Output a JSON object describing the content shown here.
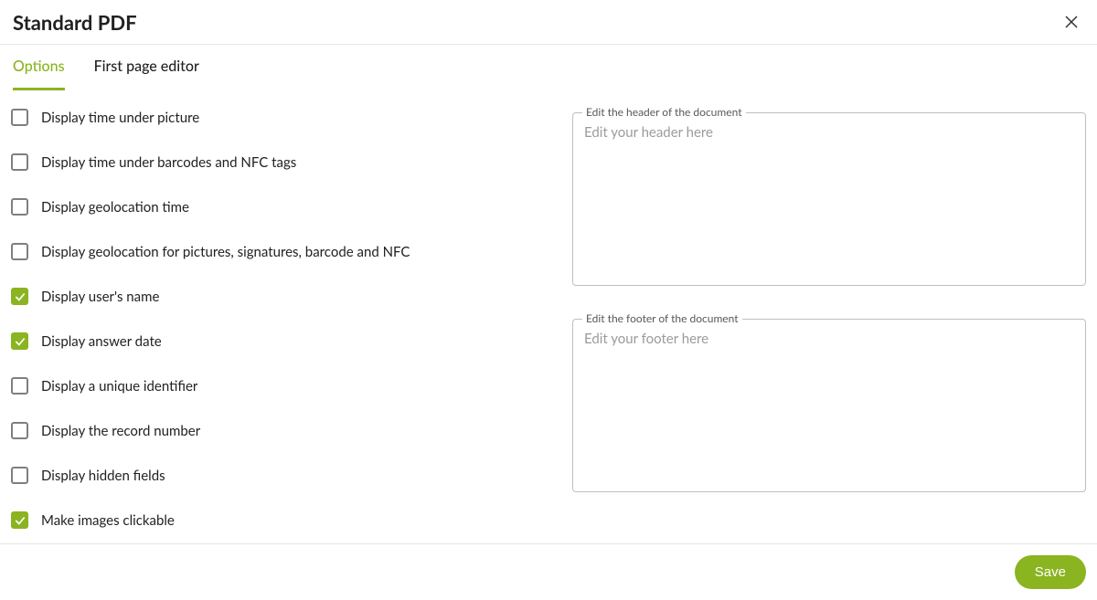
{
  "header": {
    "title": "Standard PDF"
  },
  "tabs": {
    "options": "Options",
    "first_page_editor": "First page editor"
  },
  "options": [
    {
      "label": "Display time under picture",
      "checked": false
    },
    {
      "label": "Display time under barcodes and NFC tags",
      "checked": false
    },
    {
      "label": "Display geolocation time",
      "checked": false
    },
    {
      "label": "Display geolocation for pictures, signatures, barcode and NFC",
      "checked": false
    },
    {
      "label": "Display user's name",
      "checked": true
    },
    {
      "label": "Display answer date",
      "checked": true
    },
    {
      "label": "Display a unique identifier",
      "checked": false
    },
    {
      "label": "Display the record number",
      "checked": false
    },
    {
      "label": "Display hidden fields",
      "checked": false
    },
    {
      "label": "Make images clickable",
      "checked": true
    }
  ],
  "header_field": {
    "legend": "Edit the header of the document",
    "placeholder": "Edit your header here",
    "value": ""
  },
  "footer_field": {
    "legend": "Edit the footer of the document",
    "placeholder": "Edit your footer here",
    "value": ""
  },
  "buttons": {
    "save": "Save"
  }
}
